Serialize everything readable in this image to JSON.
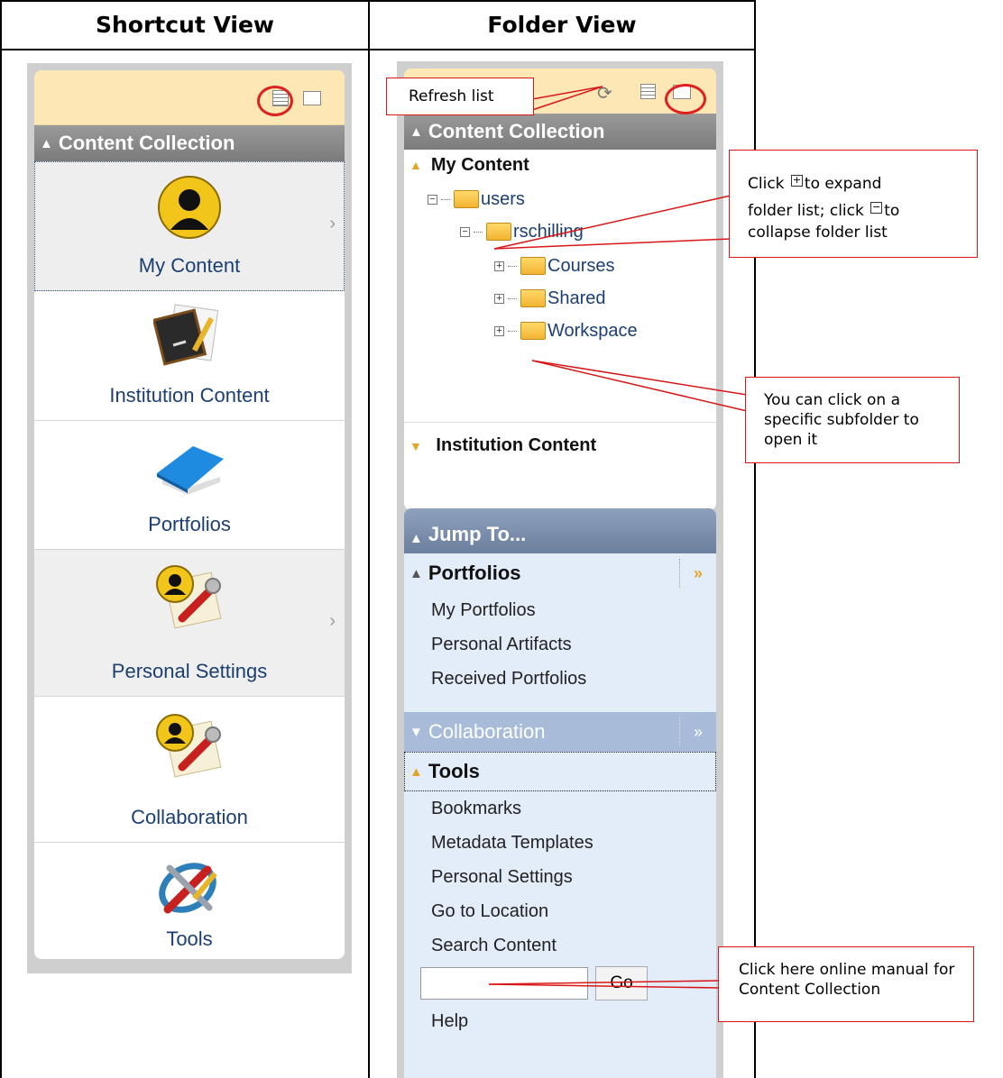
{
  "headers": {
    "left": "Shortcut View",
    "right": "Folder View"
  },
  "shortcut_view": {
    "section_title": "Content Collection",
    "tiles": [
      {
        "label": "My Content",
        "icon": "user-silhouette-icon",
        "arrow": "›"
      },
      {
        "label": "Institution Content",
        "icon": "chalkboard-icon",
        "arrow": ""
      },
      {
        "label": "Portfolios",
        "icon": "blue-folder-icon",
        "arrow": ""
      },
      {
        "label": "Personal Settings",
        "icon": "user-tools-icon",
        "arrow": "›"
      },
      {
        "label": "Collaboration",
        "icon": "user-tools-icon",
        "arrow": ""
      },
      {
        "label": "Tools",
        "icon": "tools-icon",
        "arrow": ""
      }
    ]
  },
  "folder_view": {
    "section_title": "Content Collection",
    "my_content": "My Content",
    "tree": {
      "users": "users",
      "user": "rschilling",
      "courses": "Courses",
      "shared": "Shared",
      "workspace": "Workspace"
    },
    "institution_content": "Institution Content",
    "jump_to": "Jump To...",
    "portfolios": {
      "title": "Portfolios",
      "links": [
        "My Portfolios",
        "Personal Artifacts",
        "Received Portfolios"
      ]
    },
    "collaboration": "Collaboration",
    "tools": {
      "title": "Tools",
      "links": [
        "Bookmarks",
        "Metadata Templates",
        "Personal Settings",
        "Go to Location",
        "Search Content"
      ]
    },
    "search": {
      "value": "",
      "button": "Go"
    },
    "help": "Help"
  },
  "callouts": {
    "refresh": "Refresh list",
    "expand_prefix": "Click",
    "expand_mid": "to expand",
    "expand_line2": "folder list; click",
    "expand_to": "to",
    "expand_line3": "collapse folder list",
    "subfolder": "You can click on a specific subfolder to open it",
    "help": "Click here online manual for Content Collection"
  },
  "colors": {
    "accent_red": "#d81818",
    "header_tan": "#fde7b4",
    "jump_blue": "#e3edf9"
  }
}
